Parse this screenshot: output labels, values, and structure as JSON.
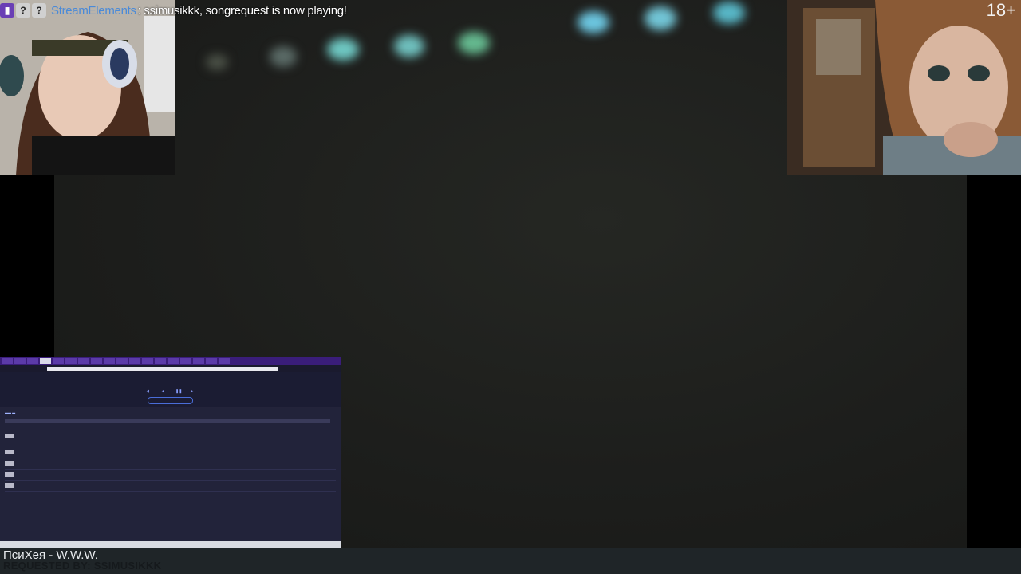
{
  "chat": {
    "badges": [
      "twitch-badge-icon",
      "help-badge-icon",
      "help-badge-icon"
    ],
    "username": "StreamElements",
    "message": ": ssimusikkk, songrequest is now playing!"
  },
  "overlay": {
    "rating": "18+"
  },
  "now_playing": {
    "title": "ПсиХея - W.W.W.",
    "requested_by": "REQUESTED BY: SSIMUSIKKK"
  },
  "browser": {
    "tab_count": 18,
    "queue_count": 4
  },
  "colors": {
    "chat_user": "#4a8ad8",
    "browser_accent": "#3a1d7a",
    "bottom_bar": "#1f2528"
  }
}
